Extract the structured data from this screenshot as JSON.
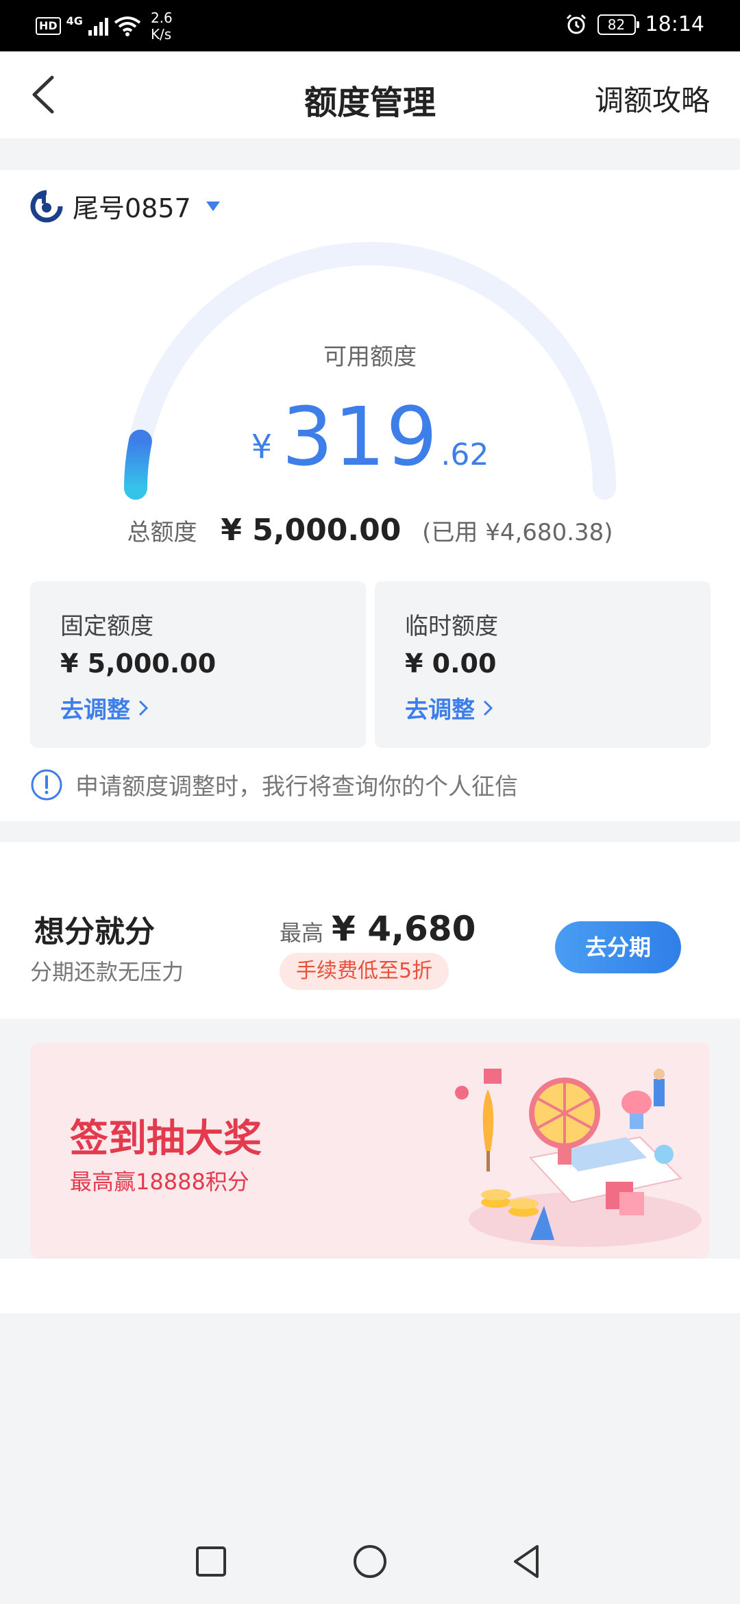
{
  "status_bar": {
    "hd": "HD",
    "network": "4G",
    "speed_value": "2.6",
    "speed_unit": "K/s",
    "battery": "82",
    "time": "18:14"
  },
  "header": {
    "title": "额度管理",
    "right_link": "调额攻略"
  },
  "account": {
    "label": "尾号0857"
  },
  "credit": {
    "available_label": "可用额度",
    "currency": "¥",
    "available_int": "319",
    "available_dec": ".62",
    "available_fraction": 0.064,
    "total_label": "总额度",
    "total_value": "¥ 5,000.00",
    "used_text": "(已用 ¥4,680.38)"
  },
  "limits": {
    "fixed": {
      "name": "固定额度",
      "value": "¥ 5,000.00",
      "action": "去调整"
    },
    "temp": {
      "name": "临时额度",
      "value": "¥ 0.00",
      "action": "去调整"
    }
  },
  "notice": "申请额度调整时，我行将查询你的个人征信",
  "installment": {
    "title": "想分就分",
    "subtitle": "分期还款无压力",
    "max_label": "最高",
    "max_value": "¥ 4,680",
    "fee_badge": "手续费低至5折",
    "button": "去分期"
  },
  "banner": {
    "title": "签到抽大奖",
    "subtitle": "最高赢18888积分"
  },
  "colors": {
    "accent": "#3d7ee9",
    "banner_red": "#e43a4e",
    "fee_red": "#e8503a"
  },
  "icons": [
    "back-arrow-icon",
    "bank-logo-icon",
    "dropdown-caret-icon",
    "info-icon",
    "chevron-right-icon",
    "home-icon",
    "back-nav-icon",
    "recents-icon"
  ]
}
